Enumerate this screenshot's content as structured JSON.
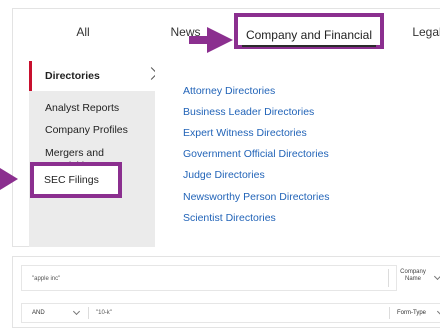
{
  "tabs": [
    {
      "label": "All"
    },
    {
      "label": "News"
    },
    {
      "label": "Company and Financial"
    },
    {
      "label": "Legal"
    }
  ],
  "sidebar": {
    "items": [
      {
        "label": "Directories"
      },
      {
        "label": "Analyst Reports"
      },
      {
        "label": "Company Profiles"
      },
      {
        "label": "Mergers and Acquisitions"
      },
      {
        "label": "SEC Filings"
      }
    ]
  },
  "directories": [
    "Attorney Directories",
    "Business Leader Directories",
    "Expert Witness Directories",
    "Government Official Directories",
    "Judge Directories",
    "Newsworthy Person Directories",
    "Scientist Directories"
  ],
  "search": {
    "query_value": "\"apple inc\"",
    "field1": "Company Name",
    "operator": "AND",
    "term2_value": "\"10-k\"",
    "field2": "Form-Type"
  },
  "colors": {
    "highlight": "#8b2f8f",
    "active_marker": "#c8102e",
    "link": "#2264b8"
  }
}
